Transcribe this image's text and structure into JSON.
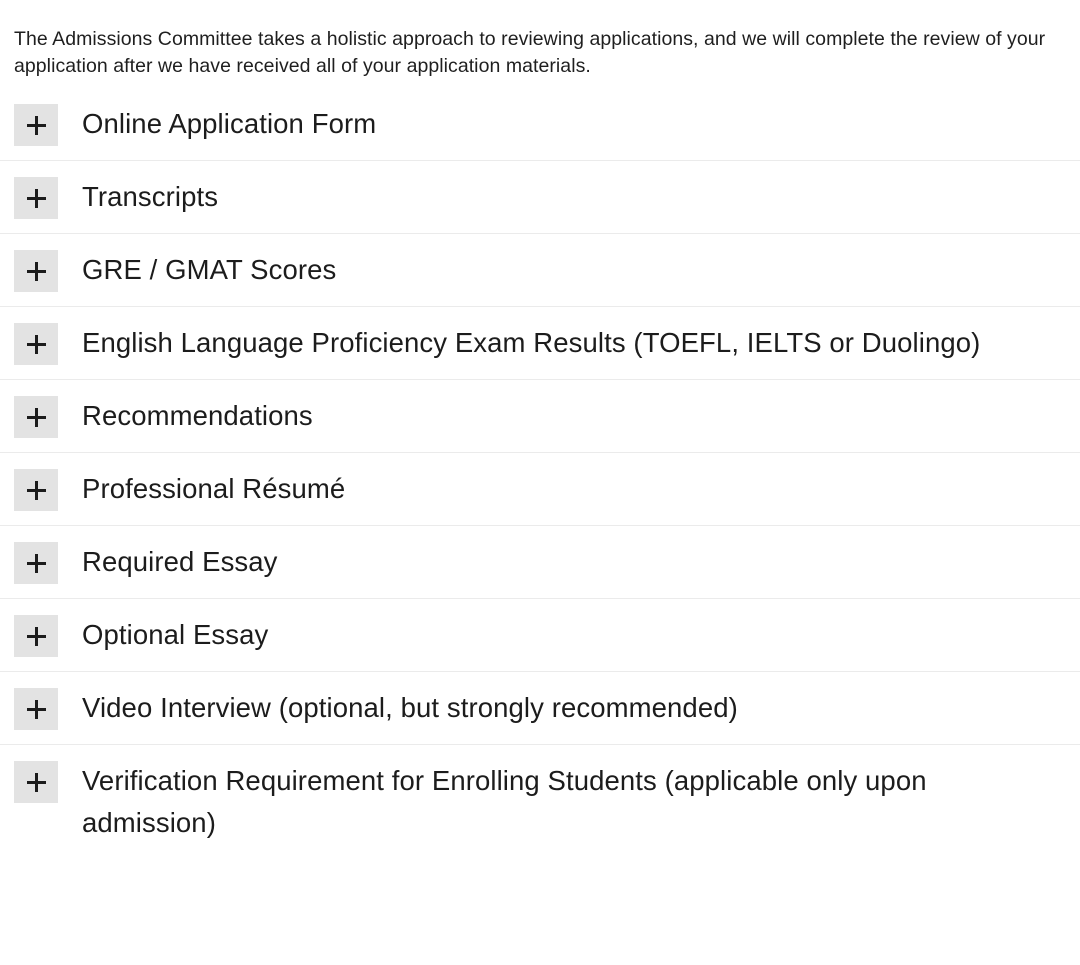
{
  "intro": {
    "paragraph": "The Admissions Committee takes a holistic approach to reviewing applications, and we will complete the review of your application after we have received all of your application materials."
  },
  "accordion": {
    "toggle_icon": "plus-icon",
    "toggle_state": "collapsed",
    "colors": {
      "toggle_background": "#e3e3e3",
      "toggle_glyph": "#1c1c1c",
      "divider": "#ebebeb",
      "text": "#1c1c1c",
      "page_background": "#ffffff"
    },
    "items": [
      {
        "label": "Online Application Form"
      },
      {
        "label": "Transcripts"
      },
      {
        "label": "GRE / GMAT Scores"
      },
      {
        "label": "English Language Proficiency Exam Results (TOEFL, IELTS or Duolingo)"
      },
      {
        "label": "Recommendations"
      },
      {
        "label": "Professional Résumé"
      },
      {
        "label": "Required Essay"
      },
      {
        "label": "Optional Essay"
      },
      {
        "label": "Video Interview (optional, but strongly recommended)"
      },
      {
        "label": "Verification Requirement for Enrolling Students (applicable only upon admission)"
      }
    ]
  }
}
